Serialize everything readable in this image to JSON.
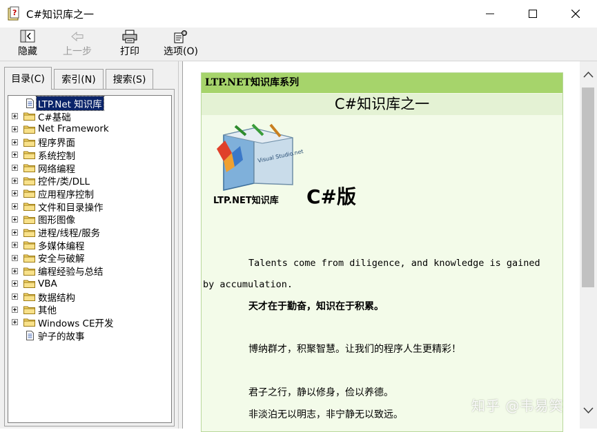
{
  "window": {
    "title": "C#知识库之一"
  },
  "toolbar": {
    "hide_label": "隐藏",
    "back_label": "上一步",
    "print_label": "打印",
    "options_label": "选项(O)"
  },
  "tabs": [
    {
      "label": "目录(C)"
    },
    {
      "label": "索引(N)"
    },
    {
      "label": "搜索(S)"
    }
  ],
  "tree": {
    "items": [
      {
        "label": "LTP.Net 知识库",
        "type": "page"
      },
      {
        "label": "C#基础",
        "type": "folder"
      },
      {
        "label": "Net Framework",
        "type": "folder"
      },
      {
        "label": "程序界面",
        "type": "folder"
      },
      {
        "label": "系统控制",
        "type": "folder"
      },
      {
        "label": "网络编程",
        "type": "folder"
      },
      {
        "label": "控件/类/DLL",
        "type": "folder"
      },
      {
        "label": "应用程序控制",
        "type": "folder"
      },
      {
        "label": "文件和目录操作",
        "type": "folder"
      },
      {
        "label": "图形图像",
        "type": "folder"
      },
      {
        "label": "进程/线程/服务",
        "type": "folder"
      },
      {
        "label": "多媒体编程",
        "type": "folder"
      },
      {
        "label": "安全与破解",
        "type": "folder"
      },
      {
        "label": "编程经验与总结",
        "type": "folder"
      },
      {
        "label": "VBA",
        "type": "folder"
      },
      {
        "label": "数据结构",
        "type": "folder"
      },
      {
        "label": "其他",
        "type": "folder"
      },
      {
        "label": "Windows CE开发",
        "type": "folder"
      },
      {
        "label": "驴子的故事",
        "type": "page"
      }
    ],
    "selected_index": 0
  },
  "content": {
    "series": "LTP.NET知识库系列",
    "title": "C#知识库之一",
    "logo_box_text": "Visual Studio.net",
    "logo_caption": "LTP.NET知识库",
    "logo_csharp": "C#版",
    "para_en_1": "Talents come from diligence, and knowledge is gained",
    "para_en_2": "by accumulation.",
    "para_zh_1": "天才在于勤奋，知识在于积累。",
    "para_zh_2": "博纳群才，积聚智慧。让我们的程序人生更精彩！",
    "para_zh_3": "君子之行，静以修身，俭以养德。",
    "para_zh_4": "非淡泊无以明志，非宁静无以致远。"
  },
  "watermark": "知乎 @韦易笑",
  "colors": {
    "series_bar": "#a6d46b",
    "title_bar": "#e4f2d4",
    "doc_background": "#f3fbe9",
    "selection": "#0a246a"
  }
}
